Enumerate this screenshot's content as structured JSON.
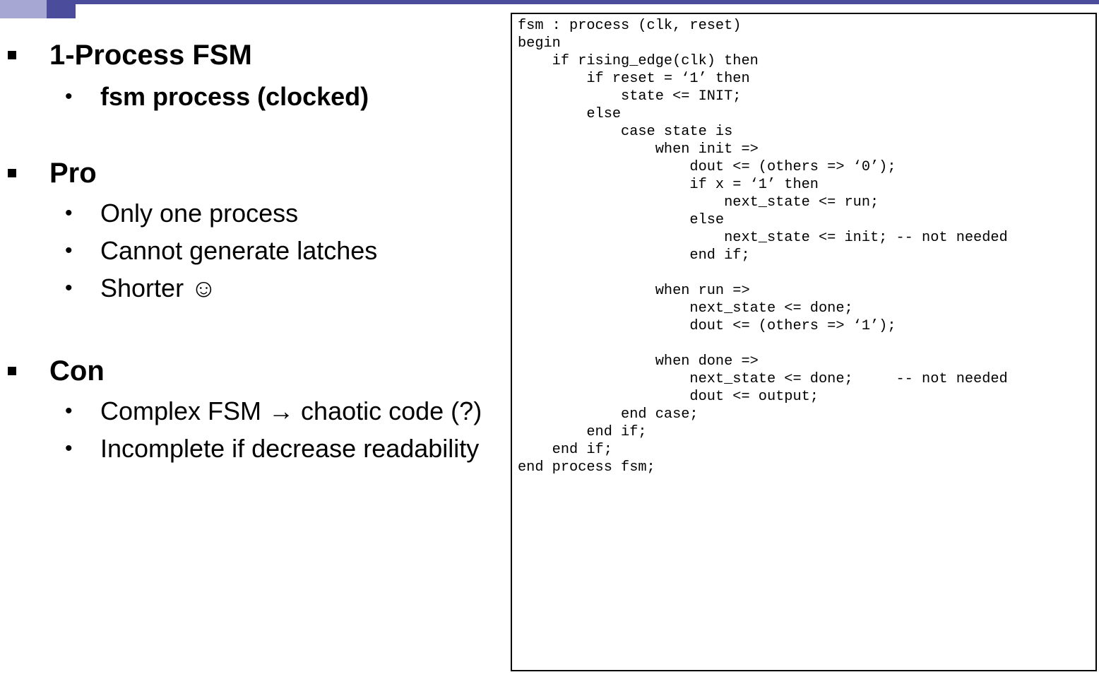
{
  "sections": [
    {
      "title": "1-Process FSM",
      "items": [
        {
          "text": "fsm process (clocked)",
          "bold": true
        }
      ]
    },
    {
      "title": "Pro",
      "items": [
        {
          "text": "Only one process",
          "bold": false
        },
        {
          "text": "Cannot generate latches",
          "bold": false
        },
        {
          "text": "Shorter ☺",
          "bold": false
        }
      ]
    },
    {
      "title": "Con",
      "items": [
        {
          "text": "Complex FSM → chaotic code (?)",
          "bold": false
        },
        {
          "text": "Incomplete if decrease readability",
          "bold": false
        }
      ]
    }
  ],
  "bullets": {
    "square": "▪",
    "dot": "•"
  },
  "code_lines": [
    "fsm : process (clk, reset)",
    "begin",
    "    if rising_edge(clk) then",
    "        if reset = ‘1’ then",
    "            state <= INIT;",
    "        else",
    "            case state is",
    "                when init =>",
    "                    dout <= (others => ‘0’);",
    "                    if x = ‘1’ then",
    "                        next_state <= run;",
    "                    else",
    "                        next_state <= init; -- not needed",
    "                    end if;",
    "",
    "                when run =>",
    "                    next_state <= done;",
    "                    dout <= (others => ‘1’);",
    "",
    "                when done =>",
    "                    next_state <= done;     -- not needed",
    "                    dout <= output;",
    "            end case;",
    "        end if;",
    "    end if;",
    "end process fsm;"
  ],
  "theme": {
    "accent": "#4b4c9c",
    "accent_light": "#a6a7d2"
  }
}
